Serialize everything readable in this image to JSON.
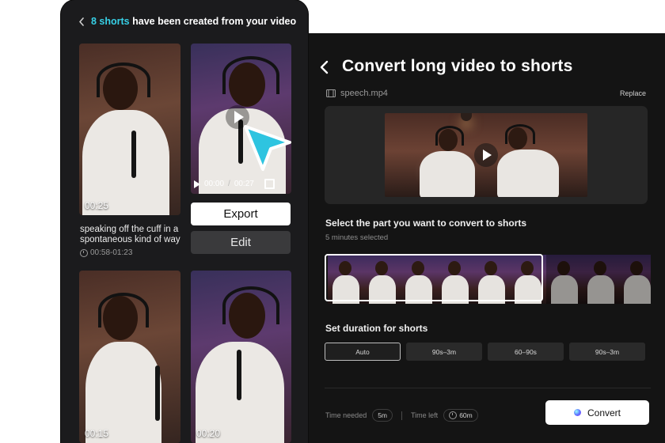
{
  "converter": {
    "title": "Convert long video to shorts",
    "file_name": "speech.mp4",
    "replace_label": "Replace",
    "select_title": "Select the part you want to convert to shorts",
    "selected_info": "5 minutes selected",
    "duration_title": "Set duration for shorts",
    "duration_options": [
      "Auto",
      "90s–3m",
      "60–90s",
      "90s–3m"
    ],
    "active_duration": "Auto",
    "time_needed_label": "Time needed",
    "time_needed_value": "5m",
    "time_left_label": "Time left",
    "time_left_value": "60m",
    "convert_label": "Convert"
  },
  "shorts": {
    "header_count": "8 shorts",
    "header_rest": "have been created from your video",
    "clips": [
      {
        "duration": "00:25",
        "caption": "speaking off the cuff in a spontaneous kind of way",
        "range": "00:58-01:23"
      },
      {
        "current": "00:00",
        "total": "00:27"
      },
      {
        "duration": "00:15"
      },
      {
        "duration": "00:20"
      }
    ],
    "export_label": "Export",
    "edit_label": "Edit"
  },
  "colors": {
    "accent_cyan": "#37d0e6",
    "panel_dark": "#141414",
    "panel_left": "#1b1b1d"
  }
}
